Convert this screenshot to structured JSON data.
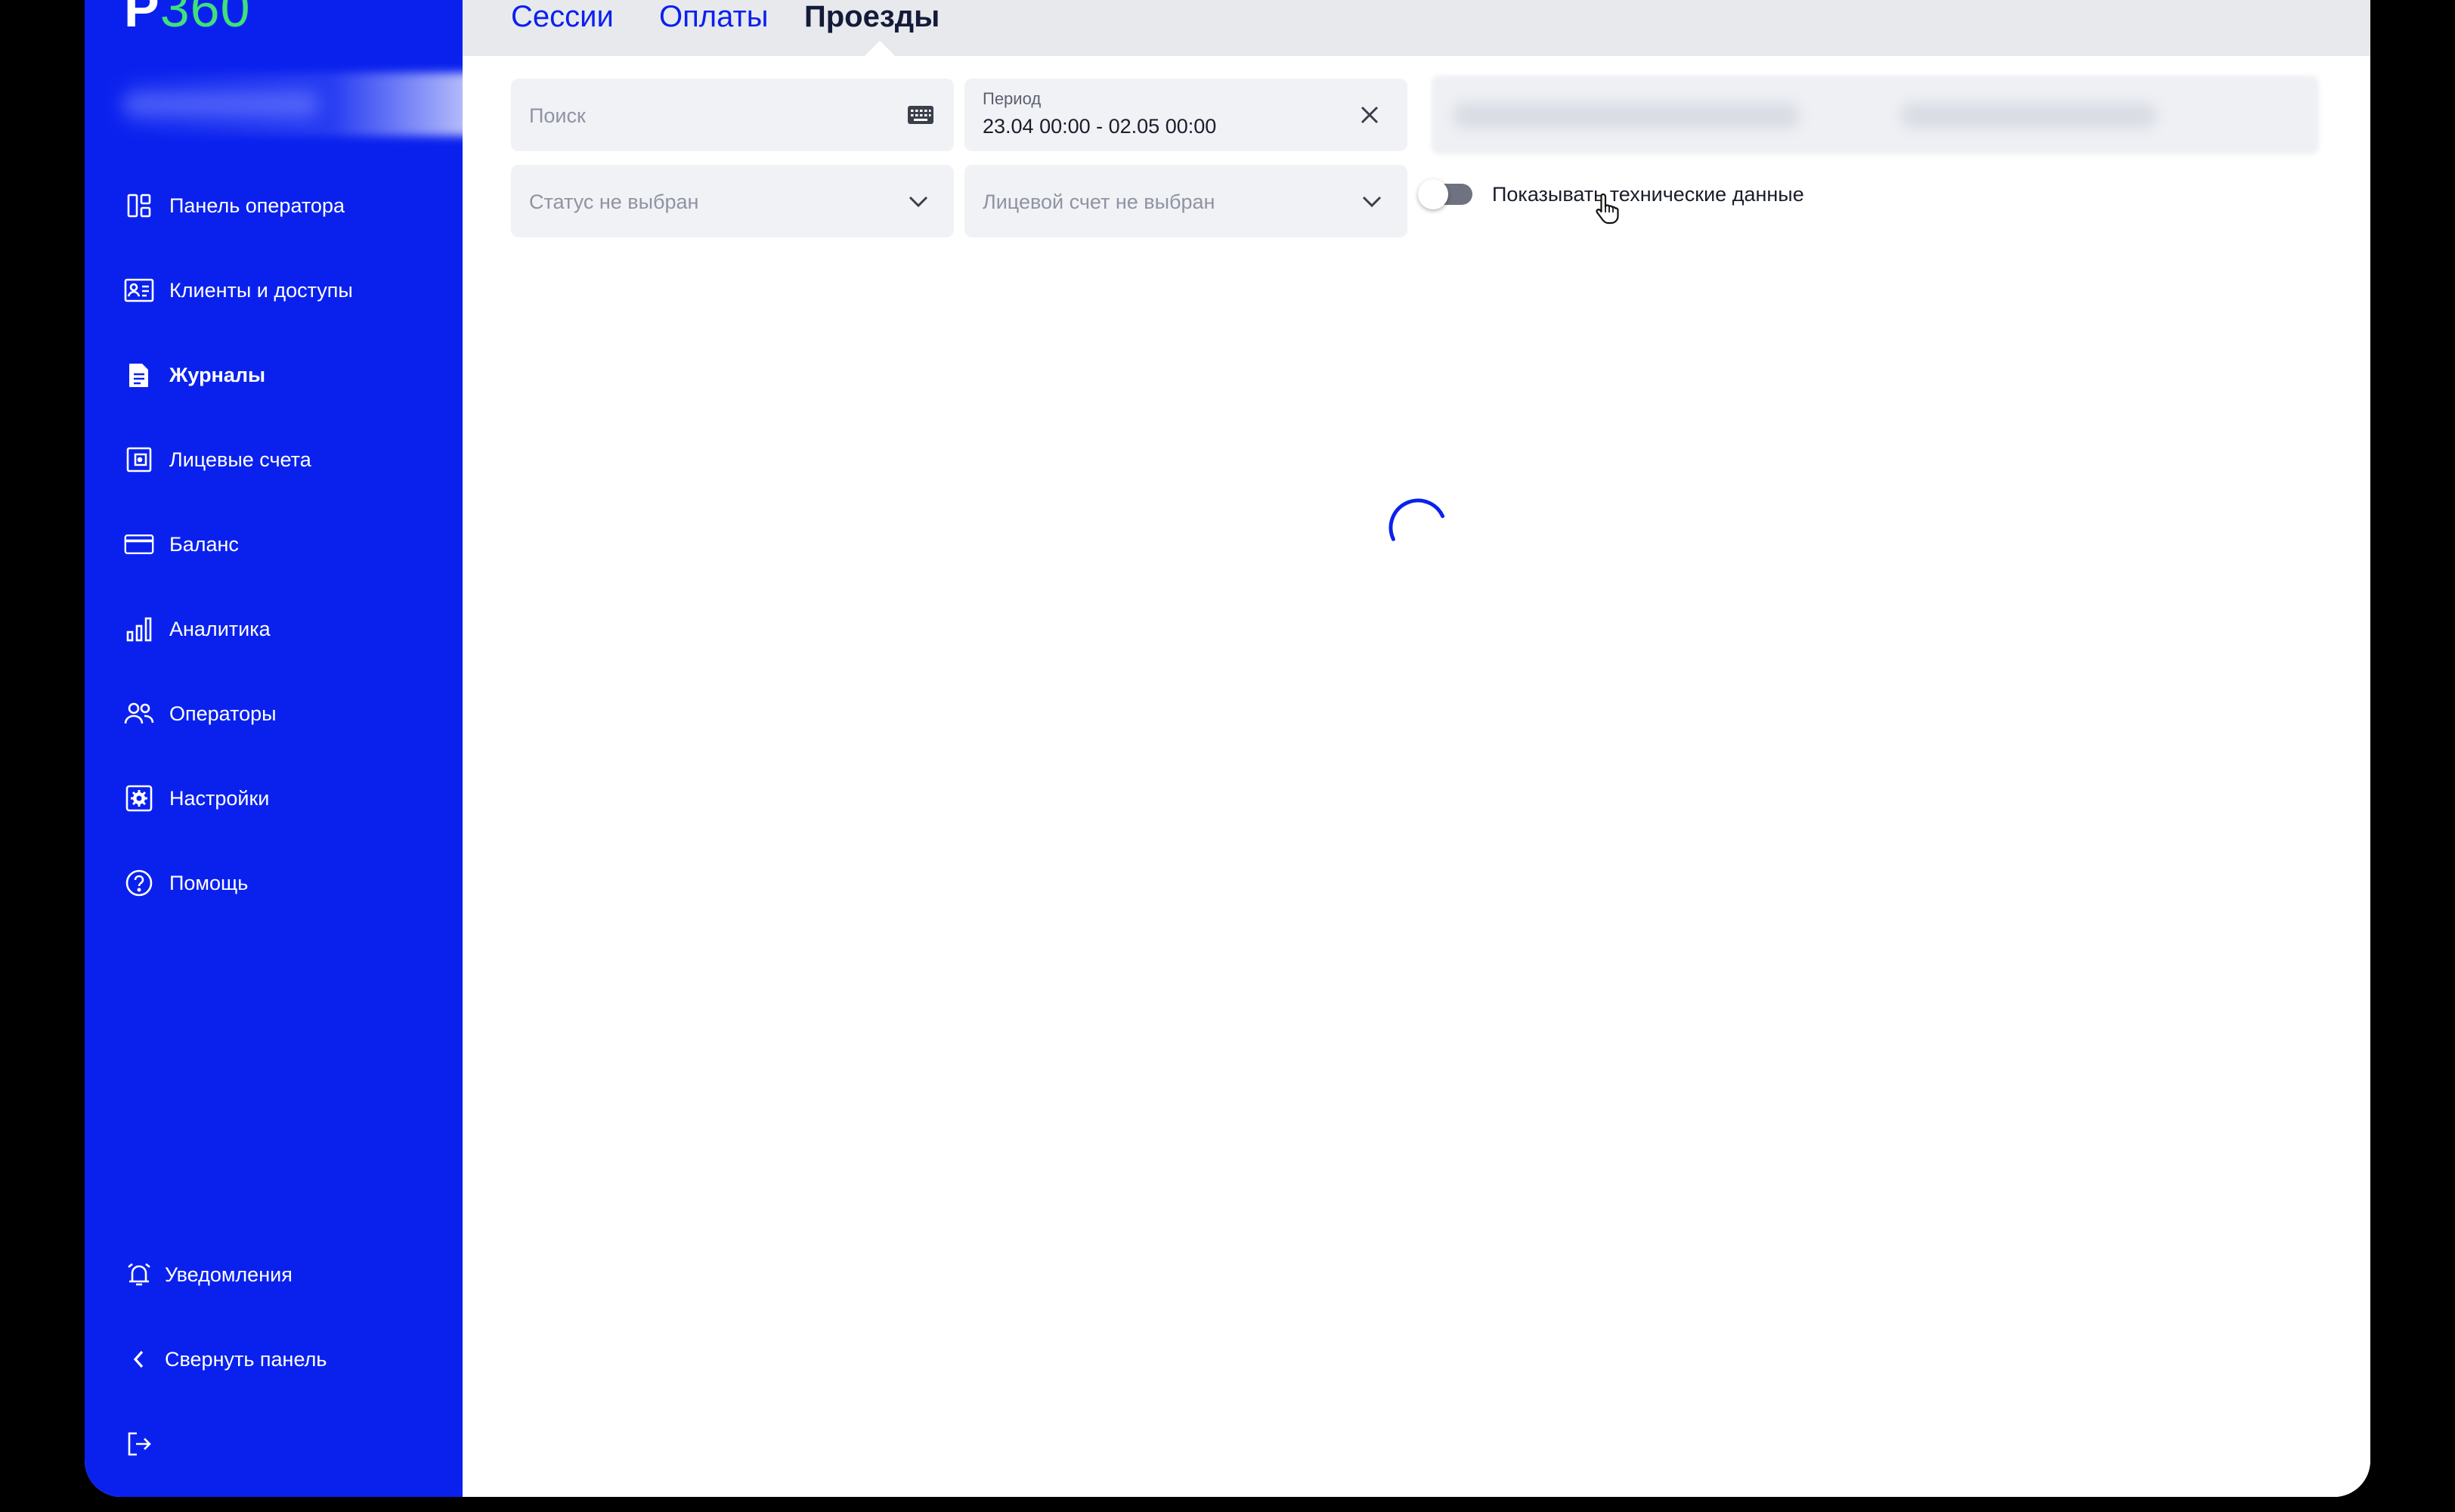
{
  "app": {
    "logo_letter": "P",
    "logo_number": "360"
  },
  "sidebar": {
    "items": [
      {
        "label": "Панель оператора",
        "icon": "dashboard-icon",
        "active": false
      },
      {
        "label": "Клиенты и доступы",
        "icon": "id-card-icon",
        "active": false
      },
      {
        "label": "Журналы",
        "icon": "document-icon",
        "active": true
      },
      {
        "label": "Лицевые счета",
        "icon": "wallet-icon",
        "active": false
      },
      {
        "label": "Баланс",
        "icon": "credit-card-icon",
        "active": false
      },
      {
        "label": "Аналитика",
        "icon": "bar-chart-icon",
        "active": false
      },
      {
        "label": "Операторы",
        "icon": "users-icon",
        "active": false
      },
      {
        "label": "Настройки",
        "icon": "gear-icon",
        "active": false
      },
      {
        "label": "Помощь",
        "icon": "help-icon",
        "active": false
      }
    ],
    "notifications_label": "Уведомления",
    "collapse_label": "Свернуть панель"
  },
  "tabs": [
    {
      "label": "Сессии",
      "active": false
    },
    {
      "label": "Оплаты",
      "active": false
    },
    {
      "label": "Проезды",
      "active": true
    }
  ],
  "filters": {
    "search_placeholder": "Поиск",
    "period_caption": "Период",
    "period_value": "23.04 00:00 - 02.05 00:00",
    "status_placeholder": "Статус не выбран",
    "account_placeholder": "Лицевой счет не выбран"
  },
  "toggle": {
    "label": "Показывать технические данные",
    "on": false
  },
  "colors": {
    "sidebar": "#0a21ee",
    "accent_green": "#3fe07a",
    "spinner": "#0a21ee"
  }
}
